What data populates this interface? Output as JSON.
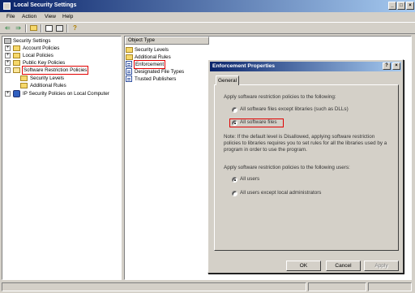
{
  "window": {
    "title": "Local Security Settings"
  },
  "menu": [
    "File",
    "Action",
    "View",
    "Help"
  ],
  "tree": {
    "root": "Security Settings",
    "items": [
      "Account Policies",
      "Local Policies",
      "Public Key Policies",
      "Software Restriction Policies",
      "Security Levels",
      "Additional Rules",
      "IP Security Policies on Local Computer"
    ]
  },
  "list": {
    "column_header": "Object Type",
    "items": [
      "Security Levels",
      "Additional Rules",
      "Enforcement",
      "Designated File Types",
      "Trusted Publishers"
    ]
  },
  "dialog": {
    "title": "Enforcement Properties",
    "help_glyph": "?",
    "close_glyph": "×",
    "tab": "General",
    "apply_to_label": "Apply software restriction policies to the following:",
    "option_except_libraries": "All software files except libraries (such as DLLs)",
    "option_all_files": "All software files",
    "note": "Note:  If the default level is Disallowed, applying software restriction policies to libraries requires you to set rules for all the libraries used by a program in order to use the program.",
    "users_label": "Apply software restriction policies to the following users:",
    "option_all_users": "All users",
    "option_except_admins": "All users except local administrators",
    "ok": "OK",
    "cancel": "Cancel",
    "apply": "Apply"
  },
  "window_controls": {
    "minimize": "_",
    "maximize": "□",
    "close": "×"
  },
  "toolbar_icons": [
    "back-arrow-icon",
    "forward-arrow-icon",
    "up-folder-icon",
    "properties-icon",
    "help-icon"
  ]
}
